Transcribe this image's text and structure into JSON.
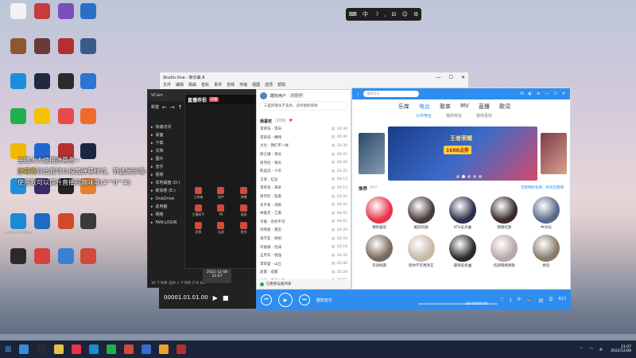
{
  "floating_toolbar": {
    "items": [
      "⌨",
      "中",
      "☽",
      "⸲",
      "⊟",
      "☺",
      "⚙"
    ]
  },
  "desktop_icons": [
    {
      "label": "",
      "color": "#f2f2f2"
    },
    {
      "label": "",
      "color": "#c93a3a"
    },
    {
      "label": "",
      "color": "#7c4dbc"
    },
    {
      "label": "",
      "color": "#2a6fc7"
    },
    {
      "label": "",
      "color": "#8a5a2c"
    },
    {
      "label": "",
      "color": "#6a3a3a"
    },
    {
      "label": "",
      "color": "#b33030"
    },
    {
      "label": "",
      "color": "#3a5a8a"
    },
    {
      "label": "",
      "color": "#1a8fd8"
    },
    {
      "label": "",
      "color": "#1f2b3c"
    },
    {
      "label": "",
      "color": "#2b2b2b"
    },
    {
      "label": "",
      "color": "#2a76d2"
    },
    {
      "label": "",
      "color": "#21b04b"
    },
    {
      "label": "",
      "color": "#f5c200"
    },
    {
      "label": "",
      "color": "#e84a4a"
    },
    {
      "label": "",
      "color": "#f06a2a"
    },
    {
      "label": "",
      "color": "#f2b800"
    },
    {
      "label": "",
      "color": "#1f66d1"
    },
    {
      "label": "",
      "color": "#b53030"
    },
    {
      "label": "",
      "color": "#1a2740"
    },
    {
      "label": "",
      "color": "#1f90e0"
    },
    {
      "label": "",
      "color": "#3a2a6c"
    },
    {
      "label": "",
      "color": "#222"
    },
    {
      "label": "",
      "color": "#e9802e"
    },
    {
      "label": "Microsoft Edge",
      "color": "#1a8ad4"
    },
    {
      "label": "",
      "color": "#1f6ac2"
    },
    {
      "label": "",
      "color": "#d24a2a"
    },
    {
      "label": "",
      "color": "#3a3a3a"
    },
    {
      "label": "",
      "color": "#2b2b2b"
    },
    {
      "label": "",
      "color": "#d94040"
    },
    {
      "label": "",
      "color": "#3a80d0"
    },
    {
      "label": "",
      "color": "#d24a3c"
    }
  ],
  "overlay_messages": [
    {
      "tag": "",
      "text": "主播大大使用弹幕秀~"
    },
    {
      "tag": "弹幕秀",
      "text": "双击我可以设置弹幕样式、筛选展示哦~"
    },
    {
      "tag": "",
      "text": "使用我可以提升直播间趣味哦(#^0^#)"
    }
  ],
  "studio_one": {
    "title": "Studio One - 新乐曲 8",
    "menu": [
      "文件",
      "编辑",
      "歌曲",
      "音轨",
      "事件",
      "音频",
      "传输",
      "视图",
      "选项",
      "帮助"
    ],
    "controls": [
      "—",
      "☐",
      "✕"
    ]
  },
  "explorer": {
    "top": "VCam",
    "new_label": "新建",
    "tree": [
      "快速访问",
      "桌面",
      "下载",
      "文档",
      "图片",
      "音乐",
      "视频",
      "本地磁盘 (D:)",
      "新加卷 (E:)",
      "OneDrive",
      "此电脑",
      "网络",
      "FAN-LOGIN"
    ],
    "status": "36 个项目  选中 1 个项目 276 KB"
  },
  "live_tool": {
    "logo": "直播伴侣",
    "pill": "开播",
    "tools": [
      "工具箱",
      "插件",
      "弹幕",
      "主播助手",
      "PK",
      "道具",
      "投票",
      "连麦",
      "更多"
    ]
  },
  "player": {
    "time": "00001.01.01.00"
  },
  "timebox": {
    "date": "2022-12-08",
    "time": "21:07"
  },
  "kugou_list": {
    "user": "酷狗用户",
    "vip": "开通VIP",
    "notice": "三里听歌永不丢失，多听福利快领",
    "section": "我喜欢",
    "count": "(209)",
    "songs": [
      {
        "name": "李荣浩 - 李白",
        "dur": "04:39"
      },
      {
        "name": "李荣浩 - 模特",
        "dur": "05:40"
      },
      {
        "name": "大壮 - 我们不一样",
        "dur": "04:30"
      },
      {
        "name": "薛之谦 - 演员",
        "dur": "04:21"
      },
      {
        "name": "周杰伦 - 晴天",
        "dur": "04:29"
      },
      {
        "name": "陈奕迅 - 十年",
        "dur": "03:25"
      },
      {
        "name": "王菲 - 红豆",
        "dur": "04:13"
      },
      {
        "name": "李荣浩 - 耳朵",
        "dur": "04:12"
      },
      {
        "name": "周杰伦 - 稻香",
        "dur": "03:43"
      },
      {
        "name": "毛不易 - 消愁",
        "dur": "04:20"
      },
      {
        "name": "林俊杰 - 江南",
        "dur": "04:42"
      },
      {
        "name": "许嵩 - 有何不可",
        "dur": "04:01"
      },
      {
        "name": "孙燕姿 - 遇见",
        "dur": "04:26"
      },
      {
        "name": "张学友 - 吻别",
        "dur": "04:59"
      },
      {
        "name": "邓紫棋 - 泡沫",
        "dur": "04:18"
      },
      {
        "name": "五月天 - 倔强",
        "dur": "04:20"
      },
      {
        "name": "李宗盛 - 山丘",
        "dur": "05:46"
      },
      {
        "name": "赵雷 - 成都",
        "dur": "05:28"
      },
      {
        "name": "朴树 - 平凡之路",
        "dur": "05:01"
      }
    ],
    "bottom": "已更新设备列表"
  },
  "kugou_main": {
    "search_placeholder": "搜索音乐",
    "tabs": [
      "乐库",
      "电台",
      "歌单",
      "MV",
      "直播",
      "歌词"
    ],
    "active_tab": "电台",
    "subtabs": [
      "公共电台",
      "我的电台",
      "猜你喜欢"
    ],
    "active_subtab": "公共电台",
    "banner": {
      "title": "王者荣耀",
      "badge": "1688点券"
    },
    "recommend_title": "推荐",
    "recommend_count": "49个",
    "recommend_more": "无限畅听免费，好玩无障碍",
    "radios": [
      {
        "label": "猜你喜欢",
        "color": "#e8334a"
      },
      {
        "label": "酷狗热歌",
        "color": "#4a3a3a"
      },
      {
        "label": "KTV必点曲",
        "color": "#2a2f4a"
      },
      {
        "label": "网络红歌",
        "color": "#3a2a2a"
      },
      {
        "label": "中文DJ",
        "color": "#5a6a8a"
      },
      {
        "label": "华语经典",
        "color": "#7a6a5a"
      },
      {
        "label": "因你不可更改又",
        "color": "#c9b8a8"
      },
      {
        "label": "最嗨名机曲",
        "color": "#2a2a2a"
      },
      {
        "label": "伤感网络情歌",
        "color": "#b9a8a8"
      },
      {
        "label": "余韵",
        "color": "#8a7a6a"
      }
    ]
  },
  "kugou_bar": {
    "title": "酷狗音乐",
    "time": "00:00/00:00",
    "count": "617"
  },
  "taskbar": {
    "icons": [
      "#3a8ad4",
      "#2a2a2a",
      "#e6c24a",
      "#e8334a",
      "#1a8ad4",
      "#21b04b",
      "#d24a3c",
      "#3a6ad4",
      "#f0a030",
      "#b33030"
    ],
    "time": "21:07",
    "date": "2022/12/08"
  },
  "colors": {
    "kugou_blue": "#2f8df0",
    "taskbar": "#1b2438"
  }
}
